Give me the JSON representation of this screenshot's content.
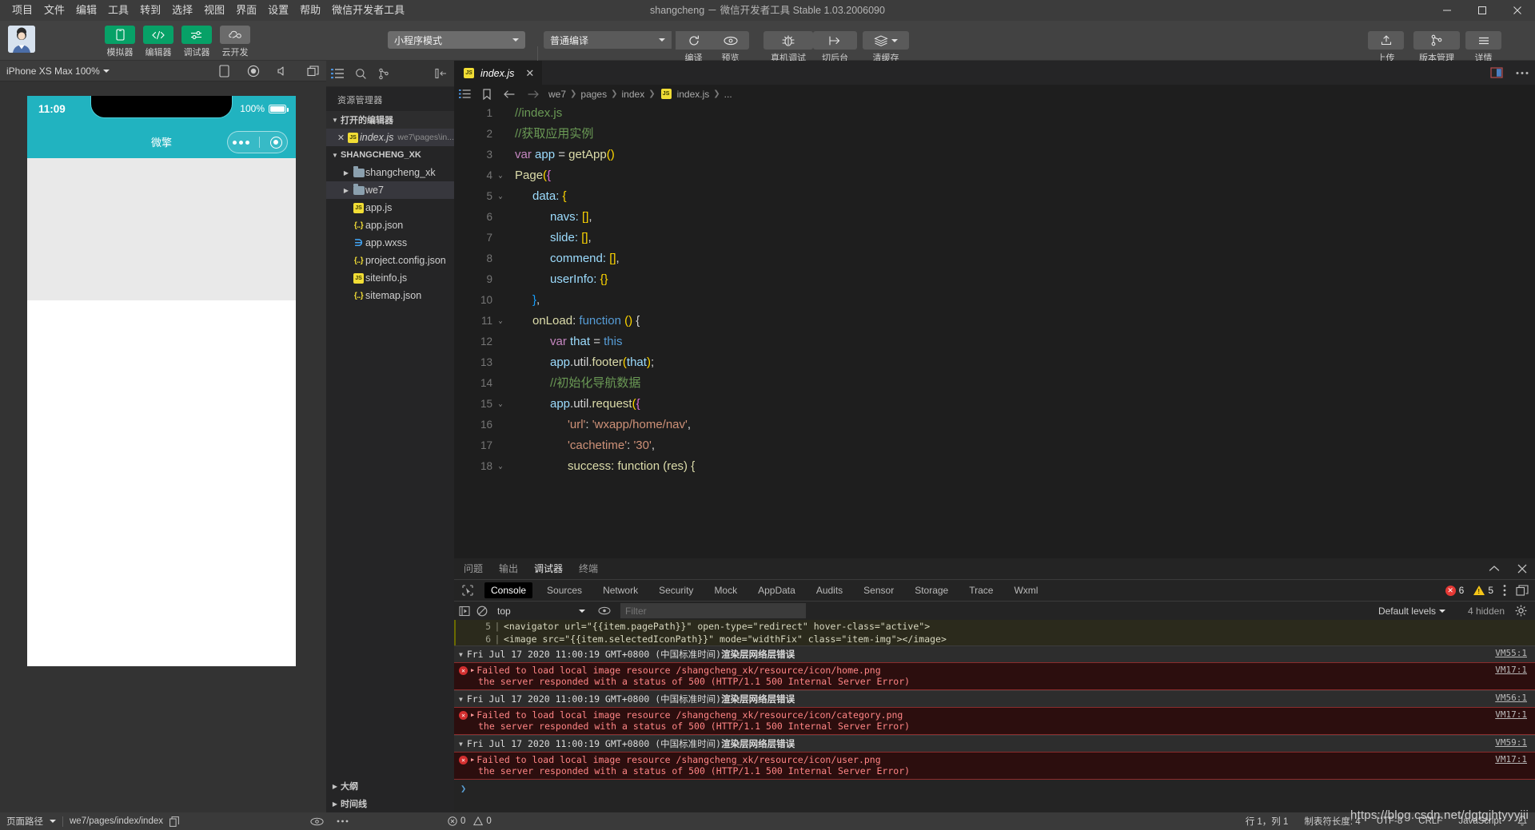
{
  "window": {
    "title": "shangcheng － 微信开发者工具 Stable 1.03.2006090",
    "minimize": "—",
    "maximize": "▢",
    "close": "✕"
  },
  "menubar": {
    "items": [
      "项目",
      "文件",
      "编辑",
      "工具",
      "转到",
      "选择",
      "视图",
      "界面",
      "设置",
      "帮助",
      "微信开发者工具"
    ]
  },
  "toolbar": {
    "buttons": [
      {
        "label": "模拟器",
        "icon": "phone-icon",
        "style": "green"
      },
      {
        "label": "编辑器",
        "icon": "code-icon",
        "style": "green"
      },
      {
        "label": "调试器",
        "icon": "debug-slider-icon",
        "style": "green"
      },
      {
        "label": "云开发",
        "icon": "cloud-icon",
        "style": "grey"
      }
    ],
    "mode_select": "小程序模式",
    "compile_select": "普通编译",
    "refresh_label": "编译",
    "preview_label": "预览",
    "actions": [
      {
        "label": "真机调试",
        "icon": "bug-icon"
      },
      {
        "label": "切后台",
        "icon": "background-icon"
      },
      {
        "label": "清缓存",
        "icon": "layers-icon"
      }
    ],
    "right_actions": [
      {
        "label": "上传",
        "icon": "upload-icon"
      },
      {
        "label": "版本管理",
        "icon": "branch-icon"
      },
      {
        "label": "详情",
        "icon": "menu-icon"
      }
    ]
  },
  "simulator": {
    "device": "iPhone XS Max 100%",
    "icons": [
      "phone-rotate-icon",
      "record-icon",
      "volume-icon",
      "multi-window-icon"
    ],
    "status_time": "11:09",
    "battery": "100%",
    "nav_title": "微擎"
  },
  "explorer": {
    "actions": [
      "files-icon",
      "search-icon",
      "source-control-icon",
      "collapse-icon"
    ],
    "title": "资源管理器",
    "open_editors_label": "打开的编辑器",
    "open_editors": [
      {
        "name": "index.js",
        "path": "we7\\pages\\in...",
        "icon": "js-icon"
      }
    ],
    "project_label": "SHANGCHENG_XK",
    "tree": [
      {
        "label": "shangcheng_xk",
        "type": "folder",
        "depth": 1
      },
      {
        "label": "we7",
        "type": "folder",
        "depth": 1,
        "selected": true
      },
      {
        "label": "app.js",
        "type": "js",
        "depth": 2
      },
      {
        "label": "app.json",
        "type": "json",
        "depth": 2
      },
      {
        "label": "app.wxss",
        "type": "wxss",
        "depth": 2
      },
      {
        "label": "project.config.json",
        "type": "json",
        "depth": 2
      },
      {
        "label": "siteinfo.js",
        "type": "js",
        "depth": 2
      },
      {
        "label": "sitemap.json",
        "type": "json",
        "depth": 2
      }
    ],
    "bottom_sections": [
      "大纲",
      "时间线"
    ],
    "bottom_counts": {
      "errors": "0",
      "warnings": "0"
    }
  },
  "editor": {
    "tab": {
      "label": "index.js",
      "icon": "js-icon",
      "close": "✕"
    },
    "tabs_right_icons": [
      "split-editor-icon",
      "more-icon"
    ],
    "breadcrumb_icons": [
      "outline-icon",
      "bookmark-icon",
      "back-arrow-icon",
      "forward-arrow-icon"
    ],
    "breadcrumb": [
      "we7",
      "pages",
      "index",
      "index.js",
      "..."
    ],
    "lines": [
      {
        "n": "1",
        "fold": "",
        "segs": [
          {
            "t": "//index.js",
            "c": "cm"
          }
        ],
        "indent": 0
      },
      {
        "n": "2",
        "fold": "",
        "segs": [
          {
            "t": "//获取应用实例",
            "c": "cm"
          }
        ],
        "indent": 0
      },
      {
        "n": "3",
        "fold": "",
        "segs": [
          {
            "t": "var ",
            "c": "kw"
          },
          {
            "t": "app ",
            "c": "id"
          },
          {
            "t": "= ",
            "c": "pl"
          },
          {
            "t": "getApp",
            "c": "fn"
          },
          {
            "t": "()",
            "c": "br3"
          }
        ],
        "indent": 0
      },
      {
        "n": "4",
        "fold": "⌄",
        "segs": [
          {
            "t": "Page",
            "c": "fn"
          },
          {
            "t": "(",
            "c": "br3"
          },
          {
            "t": "{",
            "c": "br1"
          }
        ],
        "indent": 0
      },
      {
        "n": "5",
        "fold": "⌄",
        "segs": [
          {
            "t": "data: ",
            "c": "id"
          },
          {
            "t": "{",
            "c": "br3"
          }
        ],
        "indent": 1
      },
      {
        "n": "6",
        "fold": "",
        "segs": [
          {
            "t": "navs: ",
            "c": "id"
          },
          {
            "t": "[]",
            "c": "br3"
          },
          {
            "t": ",",
            "c": "pl"
          }
        ],
        "indent": 2
      },
      {
        "n": "7",
        "fold": "",
        "segs": [
          {
            "t": "slide: ",
            "c": "id"
          },
          {
            "t": "[]",
            "c": "br3"
          },
          {
            "t": ",",
            "c": "pl"
          }
        ],
        "indent": 2
      },
      {
        "n": "8",
        "fold": "",
        "segs": [
          {
            "t": "commend: ",
            "c": "id"
          },
          {
            "t": "[]",
            "c": "br3"
          },
          {
            "t": ",",
            "c": "pl"
          }
        ],
        "indent": 2
      },
      {
        "n": "9",
        "fold": "",
        "segs": [
          {
            "t": "userInfo: ",
            "c": "id"
          },
          {
            "t": "{}",
            "c": "br3"
          }
        ],
        "indent": 2
      },
      {
        "n": "10",
        "fold": "",
        "segs": [
          {
            "t": "}",
            "c": "br2"
          },
          {
            "t": ",",
            "c": "pl"
          }
        ],
        "indent": 1
      },
      {
        "n": "11",
        "fold": "⌄",
        "segs": [
          {
            "t": "onLoad",
            "c": "fn"
          },
          {
            "t": ": ",
            "c": "pl"
          },
          {
            "t": "function ",
            "c": "kw2"
          },
          {
            "t": "()",
            "c": "br3"
          },
          {
            "t": " {",
            "c": "pl"
          }
        ],
        "indent": 1
      },
      {
        "n": "12",
        "fold": "",
        "segs": [
          {
            "t": "var ",
            "c": "kw"
          },
          {
            "t": "that ",
            "c": "id"
          },
          {
            "t": "= ",
            "c": "pl"
          },
          {
            "t": "this",
            "c": "kw2"
          }
        ],
        "indent": 2
      },
      {
        "n": "13",
        "fold": "",
        "segs": [
          {
            "t": "app",
            "c": "id"
          },
          {
            "t": ".util.",
            "c": "pl"
          },
          {
            "t": "footer",
            "c": "fn"
          },
          {
            "t": "(",
            "c": "br3"
          },
          {
            "t": "that",
            "c": "id"
          },
          {
            "t": ")",
            "c": "br3"
          },
          {
            "t": ";",
            "c": "pl"
          }
        ],
        "indent": 2
      },
      {
        "n": "14",
        "fold": "",
        "segs": [
          {
            "t": "//初始化导航数据",
            "c": "cm"
          }
        ],
        "indent": 2
      },
      {
        "n": "15",
        "fold": "⌄",
        "segs": [
          {
            "t": "app",
            "c": "id"
          },
          {
            "t": ".util.",
            "c": "pl"
          },
          {
            "t": "request",
            "c": "fn"
          },
          {
            "t": "(",
            "c": "br3"
          },
          {
            "t": "{",
            "c": "br1"
          }
        ],
        "indent": 2
      },
      {
        "n": "16",
        "fold": "",
        "segs": [
          {
            "t": "'url'",
            "c": "st"
          },
          {
            "t": ": ",
            "c": "pl"
          },
          {
            "t": "'wxapp/home/nav'",
            "c": "st"
          },
          {
            "t": ",",
            "c": "pl"
          }
        ],
        "indent": 3
      },
      {
        "n": "17",
        "fold": "",
        "segs": [
          {
            "t": "'cachetime'",
            "c": "st"
          },
          {
            "t": ": ",
            "c": "pl"
          },
          {
            "t": "'30'",
            "c": "st"
          },
          {
            "t": ",",
            "c": "pl"
          }
        ],
        "indent": 3
      },
      {
        "n": "18",
        "fold": "⌄",
        "segs": [
          {
            "t": "success: function (res) {",
            "c": "fn"
          }
        ],
        "indent": 3
      }
    ]
  },
  "devtools": {
    "panel_tabs": [
      {
        "label": "问题",
        "active": false
      },
      {
        "label": "输出",
        "active": false
      },
      {
        "label": "调试器",
        "active": true
      },
      {
        "label": "终端",
        "active": false
      }
    ],
    "panel_right_icons": [
      "chevron-up-icon",
      "close-icon"
    ],
    "cdp_tabs": [
      "Console",
      "Sources",
      "Network",
      "Security",
      "Mock",
      "AppData",
      "Audits",
      "Sensor",
      "Storage",
      "Trace",
      "Wxml"
    ],
    "cdp_active": "Console",
    "error_count": "6",
    "warning_count": "5",
    "context": "top",
    "filter_placeholder": "Filter",
    "levels_label": "Default levels",
    "hidden_label": "4 hidden",
    "source_lines": [
      {
        "n": "5",
        "text": "<navigator url=\"{{item.pagePath}}\" open-type=\"redirect\" hover-class=\"active\">"
      },
      {
        "n": "6",
        "text": "   <image src=\"{{item.selectedIconPath}}\" mode=\"widthFix\" class=\"item-img\"></image>"
      }
    ],
    "entries": [
      {
        "timestamp": "Fri Jul 17 2020 11:00:19 GMT+0800 (中国标准时间)",
        "tag": "渲染层网络层错误",
        "vm": "VM55:1",
        "error_line1": "Failed to load local image resource /shangcheng_xk/resource/icon/home.png",
        "error_line2": "the server responded with a status of 500 (HTTP/1.1 500 Internal Server Error)",
        "error_vm": "VM17:1"
      },
      {
        "timestamp": "Fri Jul 17 2020 11:00:19 GMT+0800 (中国标准时间)",
        "tag": "渲染层网络层错误",
        "vm": "VM56:1",
        "error_line1": "Failed to load local image resource /shangcheng_xk/resource/icon/category.png",
        "error_line2": "the server responded with a status of 500 (HTTP/1.1 500 Internal Server Error)",
        "error_vm": "VM17:1"
      },
      {
        "timestamp": "Fri Jul 17 2020 11:00:19 GMT+0800 (中国标准时间)",
        "tag": "渲染层网络层错误",
        "vm": "VM59:1",
        "error_line1": "Failed to load local image resource /shangcheng_xk/resource/icon/user.png",
        "error_line2": "the server responded with a status of 500 (HTTP/1.1 500 Internal Server Error)",
        "error_vm": "VM17:1"
      }
    ],
    "prompt": "❯"
  },
  "statusbar": {
    "page_path_label": "页面路径",
    "page_path": "we7/pages/index/index",
    "copy_icon": "copy-icon",
    "eye_icon": "eye-icon",
    "more_icon": "more-icon",
    "errors": "0",
    "warnings": "0",
    "cursor": "行 1，列 1",
    "tab_size": "制表符长度: 4",
    "encoding": "UTF-8",
    "eol": "CRLF",
    "language": "JavaScript",
    "bell_icon": "bell-icon"
  },
  "watermark": "https://blog.csdn.net/dgtgjhtyyyjii",
  "colors": {
    "accent_green": "#07a167",
    "phone_teal": "#21b3c0",
    "error_red": "#d32f2f",
    "arrow_red": "#e8201f"
  }
}
